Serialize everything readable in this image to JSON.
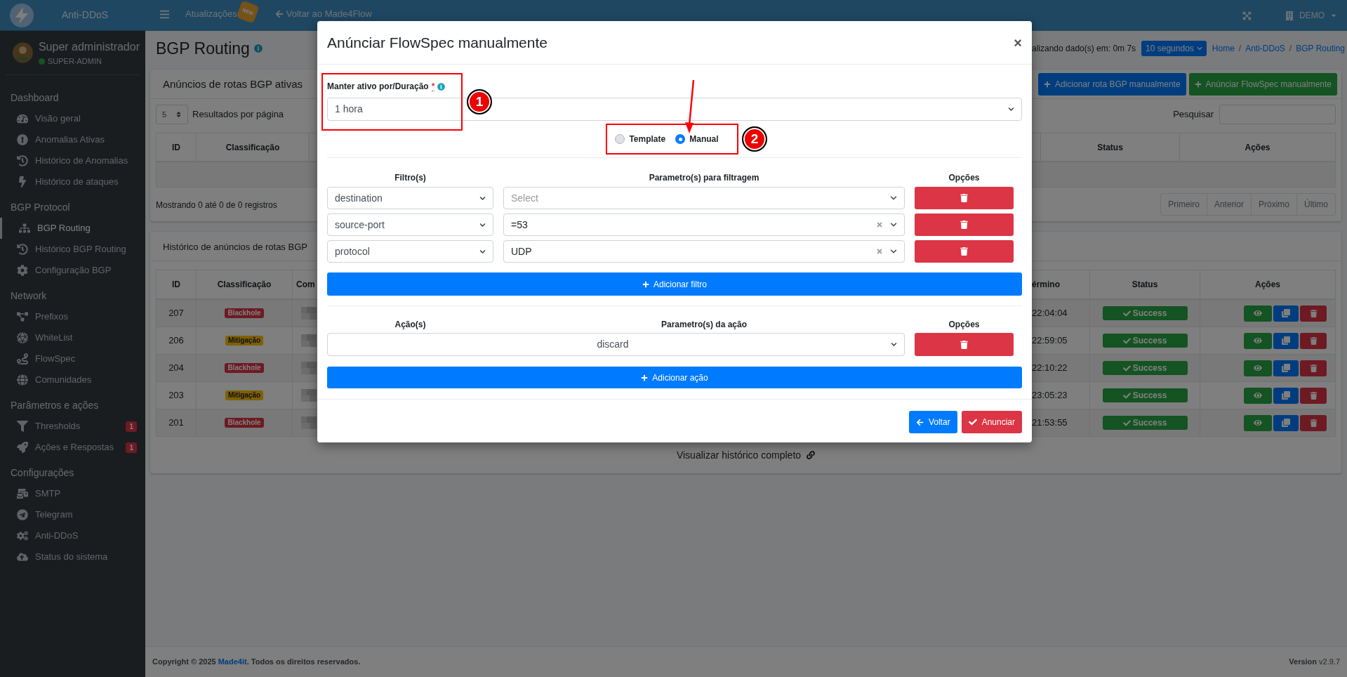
{
  "header": {
    "brand": "Anti-DDoS",
    "updates": "Atualizações",
    "new_badge": "NEW",
    "back_link": "Voltar ao Made4Flow",
    "account": "DEMO"
  },
  "sidebar": {
    "user": {
      "name": "Super administrador",
      "role": "SUPER-ADMIN"
    },
    "sections": [
      {
        "title": "Dashboard",
        "items": [
          {
            "label": "Visão geral",
            "selected": false
          },
          {
            "label": "Anomalias Ativas",
            "selected": false
          },
          {
            "label": "Histórico de Anomalias",
            "selected": false
          },
          {
            "label": "Histórico de ataques",
            "selected": false
          }
        ]
      },
      {
        "title": "BGP Protocol",
        "items": [
          {
            "label": "BGP Routing",
            "selected": true
          },
          {
            "label": "Histórico BGP Routing",
            "selected": false
          },
          {
            "label": "Configuração BGP",
            "selected": false
          }
        ]
      },
      {
        "title": "Network",
        "items": [
          {
            "label": "Prefixos",
            "selected": false
          },
          {
            "label": "WhiteList",
            "selected": false
          },
          {
            "label": "FlowSpec",
            "selected": false
          },
          {
            "label": "Comunidades",
            "selected": false
          }
        ]
      },
      {
        "title": "Parâmetros e ações",
        "items": [
          {
            "label": "Thresholds",
            "selected": false,
            "badge": "1"
          },
          {
            "label": "Ações e Respostas",
            "selected": false,
            "badge": "1"
          }
        ]
      },
      {
        "title": "Configurações",
        "items": [
          {
            "label": "SMTP",
            "selected": false
          },
          {
            "label": "Telegram",
            "selected": false
          },
          {
            "label": "Anti-DDoS",
            "selected": false
          },
          {
            "label": "Status do sistema",
            "selected": false
          }
        ]
      }
    ]
  },
  "page": {
    "title": "BGP Routing",
    "refresh_text": "alizando dado(s) em: 0m 7s",
    "refresh_interval": "10 segundos",
    "breadcrumb": [
      "Home",
      "Anti-DDoS",
      "BGP Routing"
    ],
    "breadcrumb_separator": "/"
  },
  "active_card": {
    "title": "Anúncios de rotas BGP ativas",
    "buttons": [
      {
        "label": "Adicionar rota BGP manualmente",
        "kind": "primary"
      },
      {
        "label": "Anúnciar FlowSpec manualmente",
        "kind": "success"
      }
    ],
    "page_size": "5",
    "page_size_label": "Resultados por página",
    "search_label": "Pesquisar",
    "columns_left": [
      "ID",
      "Classificação"
    ],
    "columns_right": [
      "Status",
      "Ações"
    ],
    "info": "Mostrando 0 até 0 de 0 registros",
    "pagination": [
      "Primeiro",
      "Anterior",
      "Próximo",
      "Último"
    ]
  },
  "history_card": {
    "title": "Histórico de anúncios de rotas BGP",
    "columns_left": [
      "ID",
      "Classificação",
      "Com"
    ],
    "columns_right": [
      "érmino",
      "Status",
      "Ações"
    ],
    "rows": [
      {
        "id": "207",
        "classification": "Blackhole",
        "kind": "blackhole",
        "end": "22:04:04",
        "status": "Success"
      },
      {
        "id": "206",
        "classification": "Mitigação",
        "kind": "mitigation",
        "end": "22:59:05",
        "status": "Success"
      },
      {
        "id": "204",
        "classification": "Blackhole",
        "kind": "blackhole",
        "end": "22:10:22",
        "status": "Success"
      },
      {
        "id": "203",
        "classification": "Mitigação",
        "kind": "mitigation",
        "end": "23:05:23",
        "status": "Success"
      },
      {
        "id": "201",
        "classification": "Blackhole",
        "kind": "blackhole",
        "end": "21:53:55",
        "status": "Success"
      }
    ],
    "footer_link": "Visualizar histórico completo"
  },
  "footer": {
    "copyright_prefix": "Copyright © 2025",
    "copyright_link": "Made4it",
    "copyright_suffix": ". Todos os direitos reservados.",
    "version_label": "Version",
    "version": "v2.9.7"
  },
  "modal": {
    "title": "Anúnciar FlowSpec manualmente",
    "close": "×",
    "duration": {
      "label": "Manter ativo por/Duração",
      "required": "*",
      "value": "1 hora"
    },
    "mode_options": [
      {
        "label": "Template",
        "selected": false
      },
      {
        "label": "Manual",
        "selected": true
      }
    ],
    "filters": {
      "columns": [
        "Filtro(s)",
        "Parametro(s) para filtragem",
        "Opções"
      ],
      "rows": [
        {
          "filter": "destination",
          "placeholder": "Select"
        },
        {
          "filter": "source-port",
          "param": "=53"
        },
        {
          "filter": "protocol",
          "param": "UDP"
        }
      ],
      "add_button": "Adicionar filtro"
    },
    "actions": {
      "columns": [
        "Ação(s)",
        "Parametro(s) da ação",
        "Opções"
      ],
      "rows": [
        {
          "action": "discard"
        }
      ],
      "add_button": "Adicionar ação"
    },
    "footer_buttons": [
      {
        "label": "Voltar",
        "kind": "back"
      },
      {
        "label": "Anunciar",
        "kind": "submit"
      }
    ],
    "step_markers": [
      "1",
      "2"
    ]
  }
}
